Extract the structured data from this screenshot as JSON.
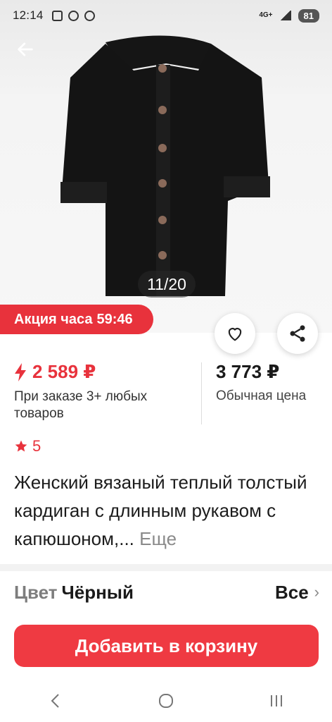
{
  "status_bar": {
    "time": "12:14",
    "network": "4G+",
    "battery": "81"
  },
  "gallery": {
    "counter": "11/20"
  },
  "promo": {
    "label": "Акция часа",
    "timer": "59:46"
  },
  "price": {
    "promo_price": "2 589 ₽",
    "promo_note": "При заказе 3+ любых товаров",
    "regular_price": "3 773 ₽",
    "regular_label": "Обычная цена"
  },
  "rating": {
    "value": "5"
  },
  "product": {
    "title": "Женский вязаный теплый толстый кардиган с длинным рукавом с капюшоном,...",
    "more_label": "Еще"
  },
  "color": {
    "label": "Цвет",
    "value": "Чёрный",
    "all_label": "Все"
  },
  "actions": {
    "add_to_cart": "Добавить в корзину"
  },
  "icons": {
    "back": "arrow-left-icon",
    "favorite": "heart-icon",
    "share": "share-icon",
    "promo_price": "lightning-icon",
    "rating": "star-icon"
  },
  "colors": {
    "accent": "#e8323c",
    "button": "#ef3a42"
  }
}
